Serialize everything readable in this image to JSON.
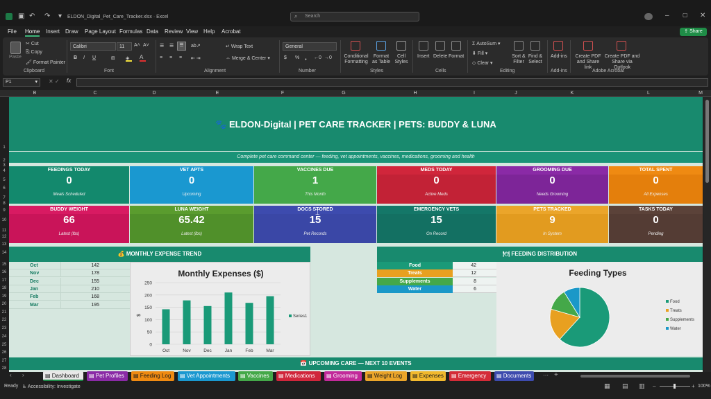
{
  "window": {
    "filename": "ELDON_Digital_Pet_Care_Tracker.xlsx",
    "app": "Excel",
    "search_placeholder": "Search"
  },
  "menu": [
    "File",
    "Home",
    "Insert",
    "Draw",
    "Page Layout",
    "Formulas",
    "Data",
    "Review",
    "View",
    "Help",
    "Acrobat"
  ],
  "share_label": "Share",
  "ribbon": {
    "paste": "Paste",
    "cut": "Cut",
    "copy": "Copy",
    "format_painter": "Format Painter",
    "clipboard": "Clipboard",
    "font_name": "Calibri",
    "font_size": "11",
    "font": "Font",
    "bold": "B",
    "italic": "I",
    "underline": "U",
    "wrap": "Wrap Text",
    "merge": "Merge & Center",
    "alignment": "Alignment",
    "number_format": "General",
    "number": "Number",
    "currency": "$",
    "percent": "%",
    "cond_fmt": "Conditional Formatting",
    "fmt_table": "Format as Table",
    "cell_styles": "Cell Styles",
    "styles": "Styles",
    "insert": "Insert",
    "delete": "Delete",
    "format": "Format",
    "cells": "Cells",
    "autosum": "AutoSum",
    "fill": "Fill",
    "clear": "Clear",
    "sort": "Sort & Filter",
    "find": "Find & Select",
    "editing": "Editing",
    "addins": "Add-ins",
    "addins_grp": "Add-ins",
    "pdf_link": "Create PDF and Share link",
    "pdf_outlook": "Create PDF and Share via Outlook",
    "acrobat": "Adobe Acrobat"
  },
  "namebox": "P1",
  "columns": [
    "B",
    "C",
    "D",
    "E",
    "F",
    "G",
    "H",
    "I",
    "J",
    "K",
    "L",
    "M"
  ],
  "rows": [
    "1",
    "2",
    "3",
    "4",
    "5",
    "6",
    "7",
    "8",
    "9",
    "10",
    "11",
    "12",
    "13",
    "14",
    "15",
    "16",
    "17",
    "18",
    "19",
    "20",
    "21",
    "22",
    "23",
    "24",
    "25",
    "26",
    "27",
    "28"
  ],
  "sheet": {
    "title": "🐾  ELDON-Digital  |  PET CARE TRACKER  |  PETS: BUDDY & LUNA",
    "subtitle": "Complete pet care command center — feeding, vet appointments, vaccines, medications, grooming and health",
    "kpi_row1": [
      {
        "head": "FEEDINGS TODAY",
        "value": "0",
        "sub": "Meals Scheduled",
        "color": "#13896d",
        "bg2": "#13896d"
      },
      {
        "head": "VET APTS",
        "value": "0",
        "sub": "Upcoming",
        "color": "#1a98d0",
        "bg2": "#1a98d0"
      },
      {
        "head": "VACCINES DUE",
        "value": "1",
        "sub": "This Month",
        "color": "#44a849",
        "bg2": "#44a849"
      },
      {
        "head": "MEDS TODAY",
        "value": "0",
        "sub": "Active Meds",
        "color": "#d0263b",
        "bg2": "#c22236"
      },
      {
        "head": "GROOMING DUE",
        "value": "0",
        "sub": "Needs Grooming",
        "color": "#8a2aa6",
        "bg2": "#7d2598"
      },
      {
        "head": "TOTAL SPENT",
        "value": "0",
        "sub": "All Expenses",
        "color": "#ef8a12",
        "bg2": "#e47f0c"
      }
    ],
    "kpi_row2": [
      {
        "head": "BUDDY WEIGHT",
        "value": "66",
        "sub": "Latest (lbs)",
        "color": "#d81a62",
        "bg2": "#c91459"
      },
      {
        "head": "LUNA WEIGHT",
        "value": "65.42",
        "sub": "Latest (lbs)",
        "color": "#5a9c2e",
        "bg2": "#50902a"
      },
      {
        "head": "DOCS STORED",
        "value": "15",
        "sub": "Pet Records",
        "color": "#3d4bae",
        "bg2": "#3a47a6"
      },
      {
        "head": "EMERGENCY VETS",
        "value": "15",
        "sub": "On Record",
        "color": "#147768",
        "bg2": "#137062"
      },
      {
        "head": "PETS TRACKED",
        "value": "9",
        "sub": "In System",
        "color": "#eba52a",
        "bg2": "#e29b1f"
      },
      {
        "head": "TASKS TODAY",
        "value": "0",
        "sub": "Pending",
        "color": "#5b4239",
        "bg2": "#543c34"
      }
    ],
    "expense_header": "MONTHLY EXPENSE TREND",
    "expense_table": [
      [
        "Oct",
        "142"
      ],
      [
        "Nov",
        "178"
      ],
      [
        "Dec",
        "155"
      ],
      [
        "Jan",
        "210"
      ],
      [
        "Feb",
        "168"
      ],
      [
        "Mar",
        "195"
      ]
    ],
    "feeding_header": "FEEDING DISTRIBUTION",
    "feeding_table": [
      [
        "Food",
        "42",
        "#1a9a78"
      ],
      [
        "Treats",
        "12",
        "#e8a020"
      ],
      [
        "Supplements",
        "8",
        "#44a849"
      ],
      [
        "Water",
        "6",
        "#1a98c8"
      ]
    ],
    "upcoming_header": "UPCOMING CARE — NEXT 10 EVENTS"
  },
  "chart_data": [
    {
      "type": "bar",
      "title": "Monthly Expenses ($)",
      "categories": [
        "Oct",
        "Nov",
        "Dec",
        "Jan",
        "Feb",
        "Mar"
      ],
      "series": [
        {
          "name": "Series1",
          "values": [
            142,
            178,
            155,
            210,
            168,
            195
          ]
        }
      ],
      "ylabel": "$",
      "ylim": [
        0,
        250
      ],
      "yticks": [
        "0",
        "50",
        "100",
        "150",
        "200",
        "250"
      ],
      "color": "#1a9a78",
      "legend": "right"
    },
    {
      "type": "pie",
      "title": "Feeding Types",
      "categories": [
        "Food",
        "Treats",
        "Supplements",
        "Water"
      ],
      "values": [
        42,
        12,
        8,
        6
      ],
      "colors": [
        "#1a9a78",
        "#e8a020",
        "#44a849",
        "#1a98c8"
      ],
      "legend": "right"
    }
  ],
  "tabs": [
    {
      "label": "Dashboard",
      "color": "#e8e8e8",
      "text": "#1a1a1a",
      "icon": "grid"
    },
    {
      "label": "Pet Profiles",
      "color": "#8a2aa6",
      "text": "#fff"
    },
    {
      "label": "Feeding Log",
      "color": "#ef8a12",
      "text": "#1a1a1a"
    },
    {
      "label": "Vet Appointments",
      "color": "#1a98d0",
      "text": "#fff"
    },
    {
      "label": "Vaccines",
      "color": "#44a849",
      "text": "#fff"
    },
    {
      "label": "Medications",
      "color": "#d0263b",
      "text": "#fff"
    },
    {
      "label": "Grooming",
      "color": "#c22a9a",
      "text": "#fff"
    },
    {
      "label": "Weight Log",
      "color": "#eba52a",
      "text": "#1a1a1a"
    },
    {
      "label": "Expenses",
      "color": "#f2b92e",
      "text": "#1a1a1a"
    },
    {
      "label": "Emergency",
      "color": "#d42b37",
      "text": "#fff"
    },
    {
      "label": "Documents",
      "color": "#3d4bae",
      "text": "#fff"
    }
  ],
  "status": {
    "ready": "Ready",
    "accessibility": "Accessibility: Investigate",
    "zoom": "100%"
  }
}
